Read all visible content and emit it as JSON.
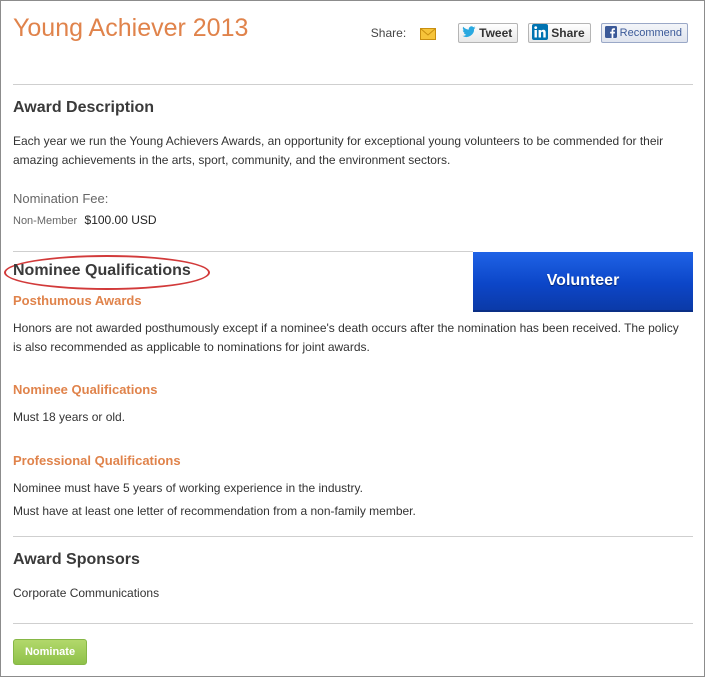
{
  "page": {
    "title": "Young Achiever 2013"
  },
  "share": {
    "label": "Share:",
    "email_icon": "email-icon",
    "tweet_label": "Tweet",
    "linkedin_label": "Share",
    "facebook_label": "Recommend",
    "colors": {
      "twitter": "#2aa9e0",
      "linkedin": "#0073b1",
      "facebook": "#3b5998",
      "email": "#f2b21b"
    }
  },
  "award_description": {
    "heading": "Award Description",
    "text": "Each year we run the Young Achievers Awards, an opportunity for exceptional young volunteers to be commended for their amazing achievements in the arts, sport, community, and the environment sectors.",
    "fee_label": "Nomination Fee:",
    "fee_member_type": "Non-Member",
    "fee_amount": "$100.00 USD"
  },
  "volunteer_button": {
    "label": "Volunteer",
    "color": "#0c46c8"
  },
  "nominee_qualifications": {
    "heading": "Nominee Qualifications",
    "highlight_color": "#d23a3a",
    "posthumous": {
      "heading": "Posthumous Awards",
      "text": "Honors are not awarded posthumously except if a nominee's death occurs after the nomination has been received. The policy is also recommended as applicable to nominations for joint awards."
    },
    "nominee": {
      "heading": "Nominee Qualifications",
      "text": "Must 18 years or old."
    },
    "professional": {
      "heading": "Professional Qualifications",
      "line1": "Nominee must have 5 years of working experience in the industry.",
      "line2": "Must have at least one letter of recommendation from a non-family member."
    }
  },
  "award_sponsors": {
    "heading": "Award Sponsors",
    "text": "Corporate Communications"
  },
  "nominate_button": {
    "label": "Nominate",
    "color": "#8fc14a"
  },
  "accent_color": "#e0834b"
}
